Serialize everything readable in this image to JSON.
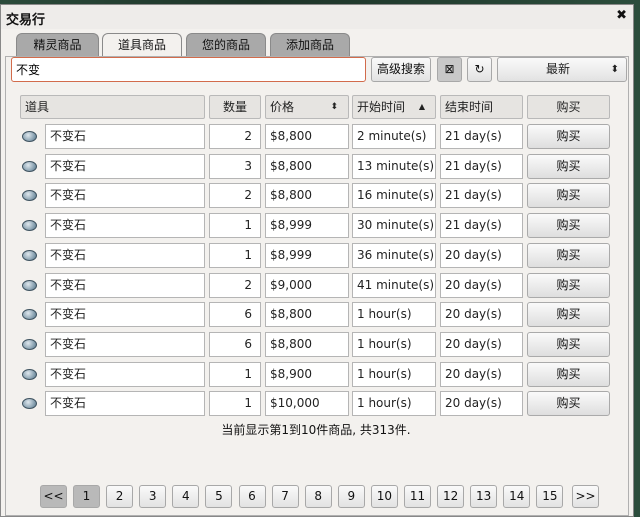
{
  "window": {
    "title": "交易行",
    "close_glyph": "✖"
  },
  "tabs": [
    {
      "label": "精灵商品"
    },
    {
      "label": "道具商品"
    },
    {
      "label": "您的商品"
    },
    {
      "label": "添加商品"
    }
  ],
  "active_tab": 1,
  "search": {
    "value": "不变",
    "advanced_label": "高级搜索",
    "clear_glyph": "⊠",
    "refresh_glyph": "↻"
  },
  "sort": {
    "selected": "最新",
    "arrow": "⬍"
  },
  "table": {
    "headers": {
      "item": "道具",
      "qty": "数量",
      "price": "价格",
      "price_sort": "⬍",
      "start": "开始时间",
      "start_sort": "▲",
      "end": "结束时间",
      "buy": "购买"
    },
    "rows": [
      {
        "name": "不变石",
        "qty": "2",
        "price": "$8,800",
        "start": "2 minute(s)",
        "end": "21 day(s)",
        "buy": "购买"
      },
      {
        "name": "不变石",
        "qty": "3",
        "price": "$8,800",
        "start": "13 minute(s)",
        "end": "21 day(s)",
        "buy": "购买"
      },
      {
        "name": "不变石",
        "qty": "2",
        "price": "$8,800",
        "start": "16 minute(s)",
        "end": "21 day(s)",
        "buy": "购买"
      },
      {
        "name": "不变石",
        "qty": "1",
        "price": "$8,999",
        "start": "30 minute(s)",
        "end": "21 day(s)",
        "buy": "购买"
      },
      {
        "name": "不变石",
        "qty": "1",
        "price": "$8,999",
        "start": "36 minute(s)",
        "end": "20 day(s)",
        "buy": "购买"
      },
      {
        "name": "不变石",
        "qty": "2",
        "price": "$9,000",
        "start": "41 minute(s)",
        "end": "20 day(s)",
        "buy": "购买"
      },
      {
        "name": "不变石",
        "qty": "6",
        "price": "$8,800",
        "start": "1 hour(s)",
        "end": "20 day(s)",
        "buy": "购买"
      },
      {
        "name": "不变石",
        "qty": "6",
        "price": "$8,800",
        "start": "1 hour(s)",
        "end": "20 day(s)",
        "buy": "购买"
      },
      {
        "name": "不变石",
        "qty": "1",
        "price": "$8,900",
        "start": "1 hour(s)",
        "end": "20 day(s)",
        "buy": "购买"
      },
      {
        "name": "不变石",
        "qty": "1",
        "price": "$10,000",
        "start": "1 hour(s)",
        "end": "20 day(s)",
        "buy": "购买"
      }
    ]
  },
  "status_text": "当前显示第1到10件商品, 共313件.",
  "pagination": {
    "prev": "<<",
    "next": ">>",
    "pages": [
      "1",
      "2",
      "3",
      "4",
      "5",
      "6",
      "7",
      "8",
      "9",
      "10",
      "11",
      "12",
      "13",
      "14",
      "15"
    ],
    "current": "1"
  }
}
